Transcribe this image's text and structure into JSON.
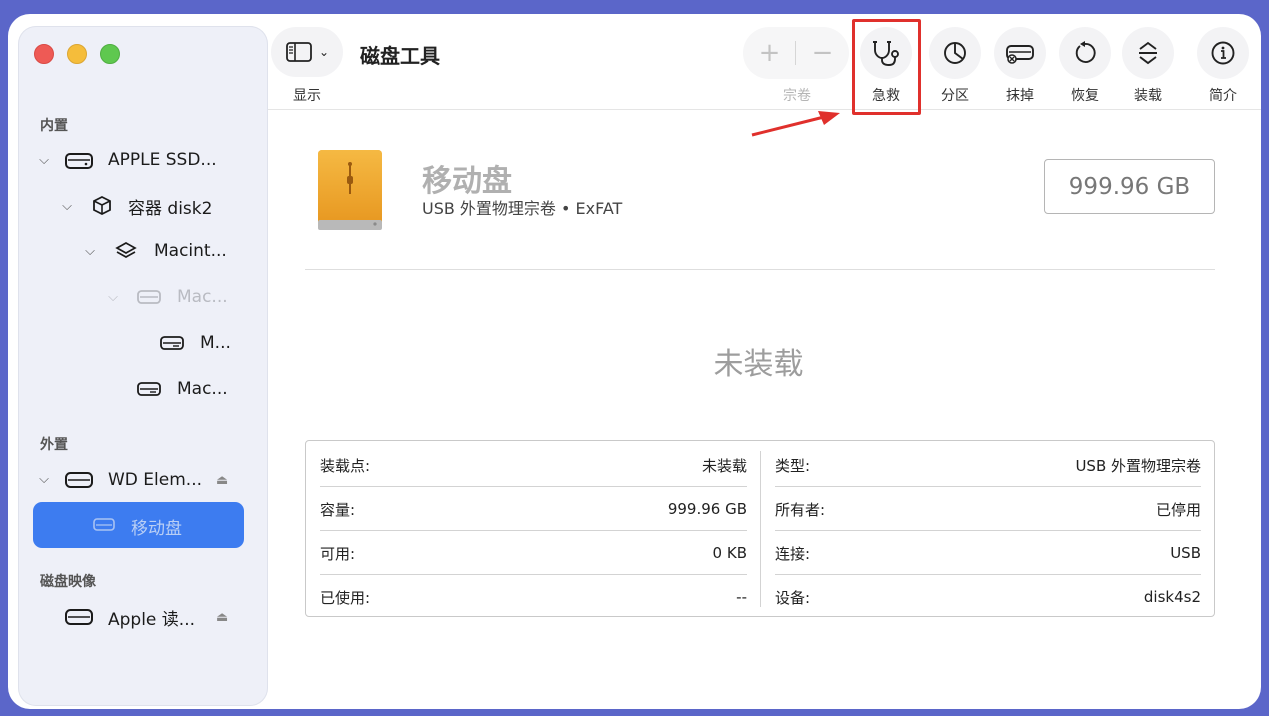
{
  "window": {
    "title": "磁盘工具",
    "accent_color": "#3d7cf0",
    "highlight_color": "#e0302c"
  },
  "sidebar": {
    "sections": {
      "internal": "内置",
      "external": "外置",
      "disk_images": "磁盘映像"
    },
    "items": [
      {
        "label": "APPLE SSD...",
        "level": 0,
        "icon": "internal-drive-icon",
        "expanded": true
      },
      {
        "label": "容器 disk2",
        "level": 1,
        "icon": "container-icon",
        "expanded": true
      },
      {
        "label": "Macint...",
        "level": 2,
        "icon": "volume-stack-icon",
        "expanded": true
      },
      {
        "label": "Mac...",
        "level": 3,
        "icon": "drive-icon",
        "expanded": true,
        "dimmed": true
      },
      {
        "label": "M...",
        "level": 4,
        "icon": "drive-icon"
      },
      {
        "label": "Mac...",
        "level": 3,
        "icon": "drive-icon"
      },
      {
        "label": "WD Elem...",
        "level": 0,
        "icon": "external-drive-icon",
        "expanded": true,
        "eject": true
      },
      {
        "label": "移动盘",
        "level": 1,
        "icon": "drive-icon",
        "selected": true
      },
      {
        "label": "Apple 读...",
        "level": 0,
        "icon": "disk-image-icon",
        "eject": true
      }
    ]
  },
  "toolbar": {
    "view_label": "显示",
    "volume_label": "宗卷",
    "buttons": [
      {
        "label": "急救",
        "icon": "stethoscope-icon",
        "highlighted": true
      },
      {
        "label": "分区",
        "icon": "pie-chart-icon"
      },
      {
        "label": "抹掉",
        "icon": "erase-drive-icon"
      },
      {
        "label": "恢复",
        "icon": "restore-icon"
      },
      {
        "label": "装载",
        "icon": "mount-icon"
      },
      {
        "label": "简介",
        "icon": "info-icon"
      }
    ]
  },
  "volume": {
    "name": "移动盘",
    "subtitle": "USB 外置物理宗卷 • ExFAT",
    "size": "999.96 GB",
    "status": "未装载"
  },
  "info": {
    "left": [
      {
        "key": "装载点:",
        "value": "未装载"
      },
      {
        "key": "容量:",
        "value": "999.96 GB"
      },
      {
        "key": "可用:",
        "value": "0 KB"
      },
      {
        "key": "已使用:",
        "value": "--"
      }
    ],
    "right": [
      {
        "key": "类型:",
        "value": "USB 外置物理宗卷"
      },
      {
        "key": "所有者:",
        "value": "已停用"
      },
      {
        "key": "连接:",
        "value": "USB"
      },
      {
        "key": "设备:",
        "value": "disk4s2"
      }
    ]
  }
}
